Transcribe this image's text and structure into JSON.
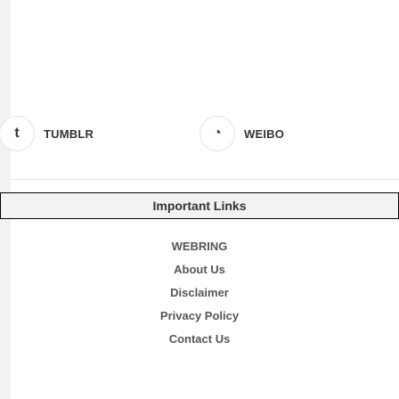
{
  "social": {
    "tumblr": {
      "label": "TUMBLR",
      "icon_glyph": "t",
      "icon": "tumblr-icon"
    },
    "weibo": {
      "label": "WEIBO",
      "icon_glyph": "◔",
      "icon": "weibo-icon"
    }
  },
  "links": {
    "title": "Important Links",
    "items": [
      {
        "label": "WEBRING"
      },
      {
        "label": "About Us"
      },
      {
        "label": "Disclaimer"
      },
      {
        "label": "Privacy Policy"
      },
      {
        "label": "Contact Us"
      }
    ]
  }
}
